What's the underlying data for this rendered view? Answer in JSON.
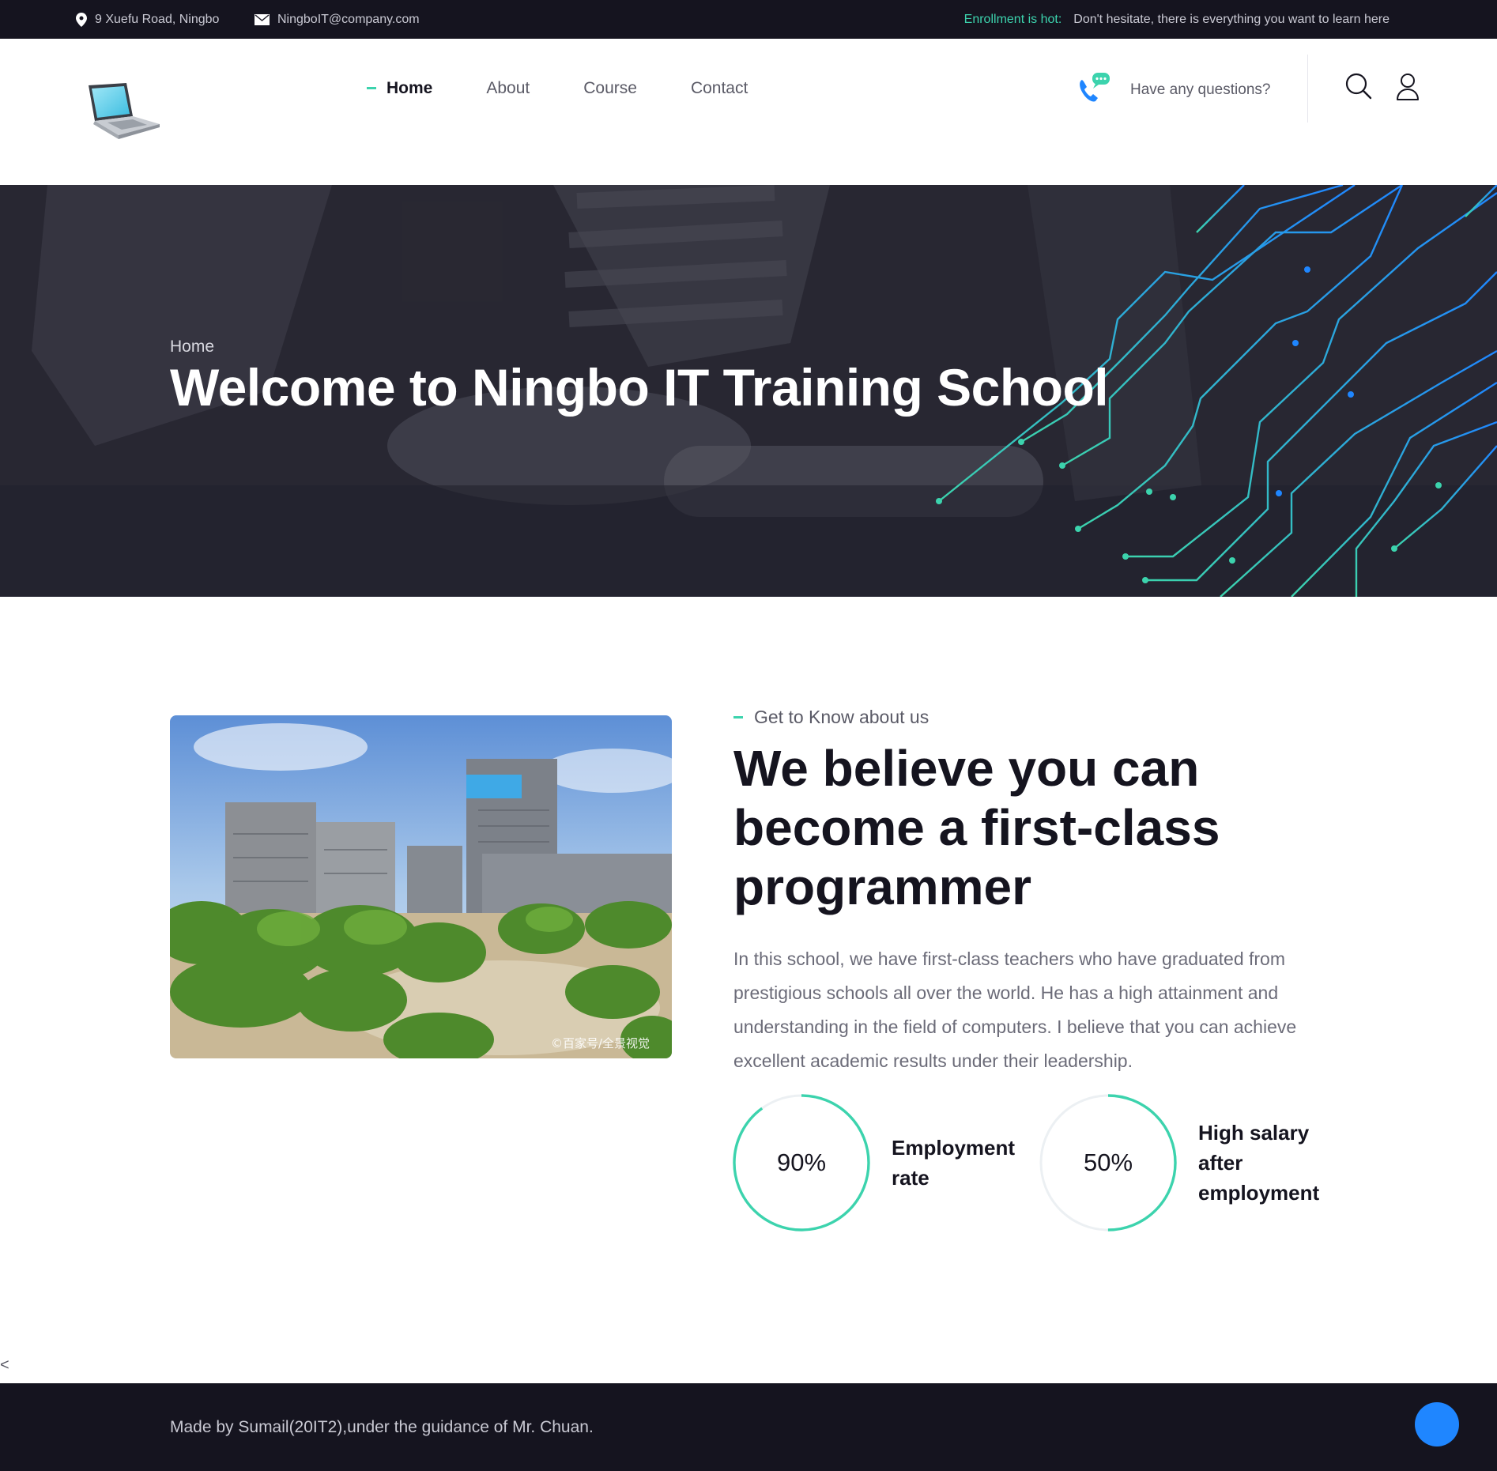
{
  "topbar": {
    "address": "9 Xuefu Road, Ningbo",
    "email": "NingboIT@company.com",
    "notice_hot": "Enrollment is hot:",
    "notice_text": "Don't hesitate, there is everything you want to learn here"
  },
  "header": {
    "nav": [
      "Home",
      "About",
      "Course",
      "Contact"
    ],
    "active_nav": "Home",
    "help_text": "Have any questions?"
  },
  "hero": {
    "breadcrumb": "Home",
    "title": "Welcome to Ningbo IT Training School"
  },
  "about": {
    "eyebrow": "Get to Know about us",
    "headline": "We believe you can become a first-class programmer",
    "paragraph": "In this school, we have first-class teachers who have graduated from prestigious schools all over the world. He has a high attainment and understanding in the field of computers. I believe that you can achieve excellent academic results under their leadership.",
    "image_watermark": "©百家号/全景视觉",
    "stats": [
      {
        "value": 90,
        "display": "90%",
        "label": "Employment rate"
      },
      {
        "value": 50,
        "display": "50%",
        "label": "High salary after employment"
      }
    ]
  },
  "stray_text": "<",
  "footer": {
    "credit": "Made by Sumail(20IT2),under the guidance of Mr. Chuan."
  },
  "colors": {
    "dark": "#15141f",
    "accent": "#3cd3ad",
    "blue": "#1f86ff",
    "text_muted": "#6b6b78"
  },
  "icons": [
    "location-pin-icon",
    "mail-icon",
    "laptop-logo-icon",
    "phone-chat-icon",
    "search-icon",
    "user-icon",
    "arrow-up-icon"
  ]
}
